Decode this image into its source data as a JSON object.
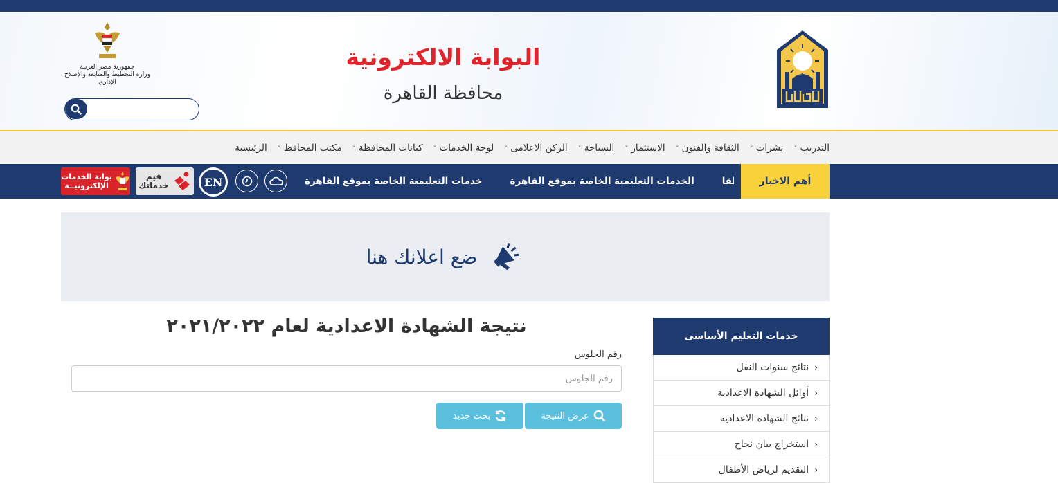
{
  "header": {
    "site_title": "البوابة الالكترونية",
    "site_subtitle": "محافظة القاهرة",
    "gov_logo_line1": "جمهورية مصر العربية",
    "gov_logo_line2": "وزارة التخطيط والمتابعة والإصلاح الإداري",
    "search_placeholder": "",
    "cairo_logo_text": "القاهرة"
  },
  "nav": {
    "items": [
      {
        "label": "الرئيسية",
        "dropdown": false
      },
      {
        "label": "مكتب المحافظ",
        "dropdown": true
      },
      {
        "label": "كيانات المحافظة",
        "dropdown": true
      },
      {
        "label": "لوحة الخدمات",
        "dropdown": true
      },
      {
        "label": "الركن الاعلامى",
        "dropdown": true
      },
      {
        "label": "السياحة",
        "dropdown": true
      },
      {
        "label": "الاستثمار",
        "dropdown": true
      },
      {
        "label": "الثقافة والفنون",
        "dropdown": true
      },
      {
        "label": "نشرات",
        "dropdown": true
      },
      {
        "label": "التدريب",
        "dropdown": true
      }
    ]
  },
  "news": {
    "label": "أهم الاخبار",
    "ticker": [
      "خدمات التعليمية الخاصة بموقع القاهرة",
      "الخدمات التعليمية الخاصة بموقع القاهرة",
      "الخدمات التعليمية الخاصة بموقع القا"
    ],
    "en_badge": "EN",
    "qeem_line1": "قيم",
    "qeem_line2": "خدماتك",
    "portal_line1": "بوابة الخدمات",
    "portal_line2": "الإلكترونيــة"
  },
  "ad": {
    "text": "ضع اعلانك هنا"
  },
  "main": {
    "heading": "نتيجة الشهادة الاعدادية لعام ٢٠٢١/٢٠٢٢",
    "field_label": "رقم الجلوس",
    "field_placeholder": "رقم الجلوس",
    "btn_result": "عرض النتيجة",
    "btn_new": "بحث جديد"
  },
  "sidebar": {
    "title": "خدمات التعليم الأساسى",
    "items": [
      {
        "label": "نتائج سنوات النقل"
      },
      {
        "label": "أوائل الشهادة الاعدادية"
      },
      {
        "label": "نتائج الشهادة الاعدادية"
      },
      {
        "label": "استخراج بيان نجاح"
      },
      {
        "label": "التقديم لرياض الأطفال"
      }
    ]
  },
  "colors": {
    "navy": "#1e3a6e",
    "gold": "#f9d13b",
    "red": "#e0242b",
    "button": "#5bc0de"
  }
}
